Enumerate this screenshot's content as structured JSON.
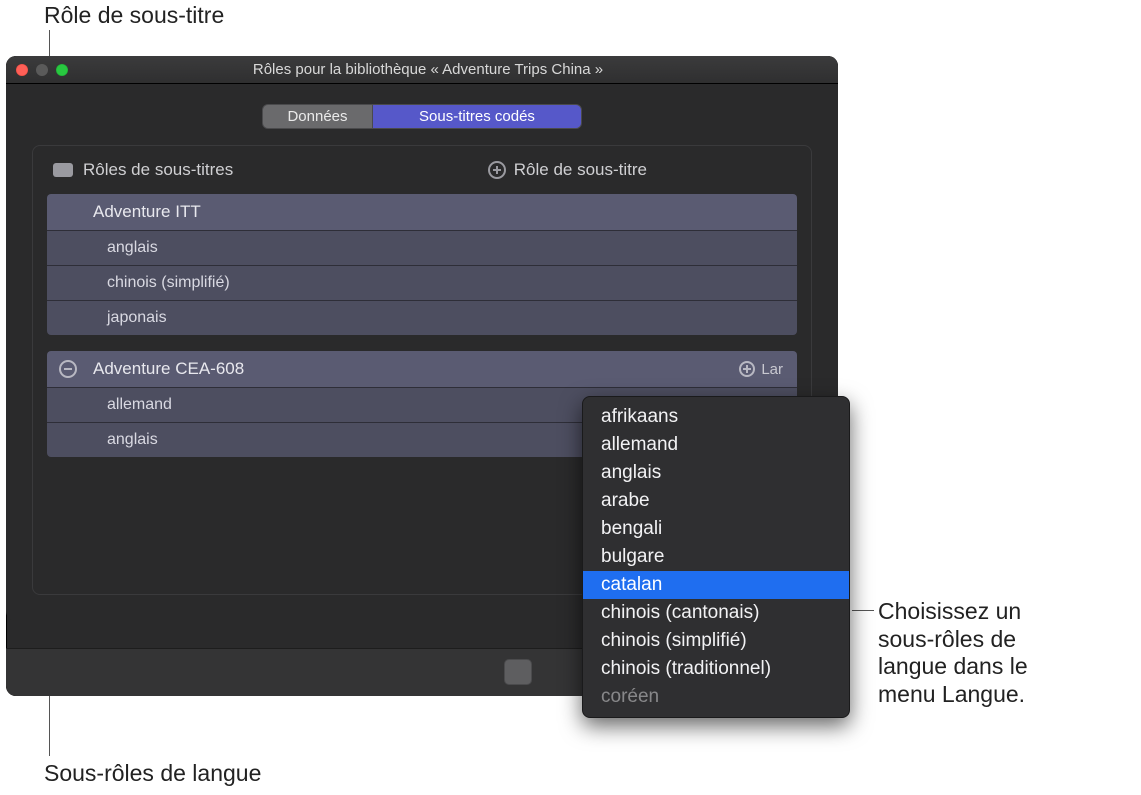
{
  "callouts": {
    "top": "Rôle de sous-titre",
    "bottom": "Sous-rôles de langue",
    "right": "Choisissez un\nsous-rôles de\nlangue dans le\nmenu Langue."
  },
  "window": {
    "title": "Rôles pour la bibliothèque « Adventure Trips China »",
    "tabs": {
      "data": "Données",
      "captions": "Sous-titres codés"
    },
    "section": {
      "title": "Rôles de sous-titres",
      "add_label": "Rôle de sous-titre"
    },
    "roles": [
      {
        "name": "Adventure ITT",
        "show_minus": false,
        "show_lang_add": false,
        "sub": [
          "anglais",
          "chinois (simplifié)",
          "japonais"
        ]
      },
      {
        "name": "Adventure CEA-608",
        "show_minus": true,
        "show_lang_add": true,
        "lang_add_label": "Lar",
        "sub": [
          "allemand",
          "anglais"
        ]
      }
    ]
  },
  "language_menu": {
    "selected_index": 6,
    "items": [
      "afrikaans",
      "allemand",
      "anglais",
      "arabe",
      "bengali",
      "bulgare",
      "catalan",
      "chinois (cantonais)",
      "chinois (simplifié)",
      "chinois (traditionnel)",
      "coréen"
    ]
  }
}
